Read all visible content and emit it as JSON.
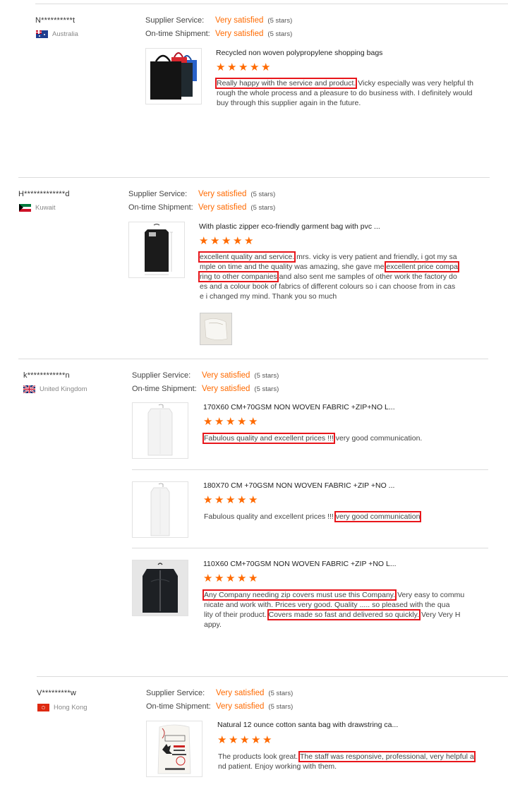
{
  "labels": {
    "supplier_service": "Supplier Service:",
    "ontime_shipment": "On-time Shipment:",
    "very_satisfied": "Very satisfied",
    "five_stars": "(5 stars)"
  },
  "colors": {
    "accent": "#ff6a00",
    "highlight": "#e8161b"
  },
  "reviews": [
    {
      "buyer": "N**********t",
      "country": "Australia",
      "flag_icon": "australia-flag-icon",
      "products": [
        {
          "title": "Recycled non woven polypropylene shopping bags",
          "thumb_icon": "shopping-bags-icon",
          "feedback": [
            "Really happy with the service and product.",
            " Vicky especially  was very helpful th",
            "rough the whole process and a pleasure to do business with. I definitely would",
            "buy through this supplier again in the future."
          ]
        }
      ]
    },
    {
      "buyer": "H*************d",
      "country": "Kuwait",
      "flag_icon": "kuwait-flag-icon",
      "products": [
        {
          "title": "With plastic zipper eco-friendly garment bag with pvc ...",
          "thumb_icon": "garment-bag-icon",
          "feedback": [
            "excellent quality and service.",
            " mrs. vicky is very patient and friendly, i got my sa",
            "mple on time and the quality was amazing, she gave me ",
            "excellent price compa",
            "ring to other companies",
            " and also sent me samples of other work the factory do",
            "es and a colour book of fabrics of different colours so i can choose from in cas",
            "e i changed my mind. Thank you so much"
          ]
        }
      ]
    },
    {
      "buyer": "k************n",
      "country": "United Kingdom",
      "flag_icon": "uk-flag-icon",
      "products": [
        {
          "title": "170X60 CM+70GSM NON WOVEN FABRIC +ZIP+NO L...",
          "thumb_icon": "white-garment-bag-icon",
          "feedback": [
            "Fabulous quality and excellent prices !!!",
            " very good communication."
          ]
        },
        {
          "title": "180X70 CM +70GSM NON WOVEN FABRIC +ZIP +NO ...",
          "thumb_icon": "white-garment-bag-icon",
          "feedback": [
            "Fabulous quality and excellent prices !!! ",
            "very good communication"
          ]
        },
        {
          "title": "110X60 CM+70GSM NON WOVEN FABRIC +ZIP +NO L...",
          "thumb_icon": "black-garment-bag-icon",
          "feedback": [
            "Any Company needing zip covers must use this Company.",
            " Very easy to commu",
            "nicate and work with. Prices very good. Quality ..... so pleased with the qua",
            "lity of their product. ",
            "Covers made so fast and delivered so quickly.",
            " Very Very H",
            "appy."
          ]
        }
      ]
    },
    {
      "buyer": "V*********w",
      "country": "Hong Kong",
      "flag_icon": "hong-kong-flag-icon",
      "products": [
        {
          "title": "Natural 12 ounce cotton santa bag with drawstring ca...",
          "thumb_icon": "santa-sack-icon",
          "feedback": [
            "The products look great. ",
            "The staff was responsive, professional, very helpful a",
            "nd patient. Enjoy working with them."
          ]
        }
      ]
    }
  ]
}
